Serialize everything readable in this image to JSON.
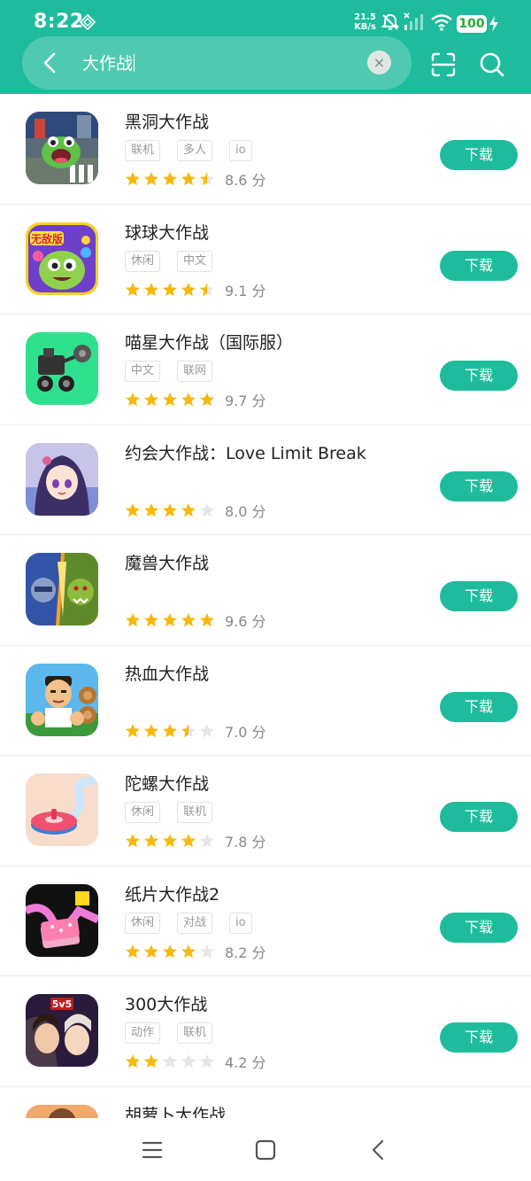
{
  "status_bar": {
    "time": "8:22",
    "net_speed_value": "21.5",
    "net_speed_unit": "KB/s",
    "battery": "100",
    "icons": [
      "vpn-diamond-icon",
      "mute-icon",
      "signal-icon",
      "wifi-icon",
      "battery-icon",
      "charging-icon"
    ]
  },
  "search": {
    "query": "大作战",
    "clear_label": "×"
  },
  "colors": {
    "accent": "#1ebc9c",
    "star": "#f6b80e",
    "star_empty": "#e6e6e6"
  },
  "apps": [
    {
      "title": "黑洞大作战",
      "tags": [
        "联机",
        "多人",
        "io"
      ],
      "score": "8.6 分",
      "stars": 4.5,
      "button": "下载",
      "icon": "hole-io-game-icon"
    },
    {
      "title": "球球大作战",
      "tags": [
        "休闲",
        "中文"
      ],
      "score": "9.1 分",
      "stars": 4.5,
      "button": "下载",
      "icon": "ball-battle-game-icon"
    },
    {
      "title": "喵星大作战（国际服）",
      "tags": [
        "中文",
        "联网"
      ],
      "score": "9.7 分",
      "stars": 5,
      "button": "下载",
      "icon": "meow-battle-game-icon"
    },
    {
      "title": "约会大作战：Love Limit Break",
      "tags": [],
      "score": "8.0 分",
      "stars": 4,
      "button": "下载",
      "icon": "date-a-live-game-icon"
    },
    {
      "title": "魔兽大作战",
      "tags": [],
      "score": "9.6 分",
      "stars": 5,
      "button": "下载",
      "icon": "warcraft-battle-game-icon"
    },
    {
      "title": "热血大作战",
      "tags": [],
      "score": "7.0 分",
      "stars": 3.5,
      "button": "下载",
      "icon": "hot-blood-battle-game-icon"
    },
    {
      "title": "陀螺大作战",
      "tags": [
        "休闲",
        "联机"
      ],
      "score": "7.8 分",
      "stars": 4,
      "button": "下载",
      "icon": "spinning-top-game-icon"
    },
    {
      "title": "纸片大作战2",
      "tags": [
        "休闲",
        "对战",
        "io"
      ],
      "score": "8.2 分",
      "stars": 4,
      "button": "下载",
      "icon": "paper-io-game-icon"
    },
    {
      "title": "300大作战",
      "tags": [
        "动作",
        "联机"
      ],
      "score": "4.2 分",
      "stars": 2,
      "button": "下载",
      "icon": "300-battle-game-icon"
    },
    {
      "title": "胡萝卜大作战",
      "tags": [],
      "score": "",
      "stars": 0,
      "button": "",
      "icon": "carrot-battle-game-icon"
    }
  ],
  "nav": {
    "icons": [
      "menu-icon",
      "home-icon",
      "back-icon"
    ]
  }
}
